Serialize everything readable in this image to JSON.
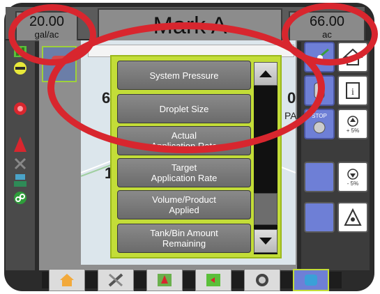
{
  "header": {
    "app_rate_left": {
      "value": "20.00",
      "unit": "gal/ac"
    },
    "title": "Mark A",
    "area_right": {
      "value": "66.00",
      "unit": "ac"
    }
  },
  "background": {
    "left_partial": "6",
    "right_partial": "0",
    "right_unit_partial": "PA",
    "left_partial2": "1"
  },
  "selection_menu": {
    "items": [
      {
        "label": "System Pressure"
      },
      {
        "label": "Droplet Size"
      },
      {
        "label": "Actual\nApplication Rate"
      },
      {
        "label": "Target\nApplication Rate"
      },
      {
        "label": "Volume/Product\nApplied"
      },
      {
        "label": "Tank/Bin Amount\nRemaining"
      }
    ],
    "scroll_up_icon": "chevron-up-icon",
    "scroll_down_icon": "chevron-down-icon"
  },
  "right_panel": {
    "stop_label": "STOP",
    "rate_up_label": "+ 5%",
    "rate_down_label": "- 5%",
    "icons": [
      "guidance-icon",
      "home-icon",
      "tank-icon",
      "info-icon",
      "stop-icon",
      "rate-increase-icon",
      "rate-decrease-icon",
      "product-icon"
    ]
  },
  "bottom_nav": {
    "icons": [
      "home-icon",
      "tools-icon",
      "guidance-icon",
      "map-icon",
      "camera-icon",
      "tank-icon"
    ]
  },
  "colors": {
    "highlight": "#d8262e",
    "popup_bg": "#c3dd38",
    "button_blue": "#6e7fd6"
  }
}
